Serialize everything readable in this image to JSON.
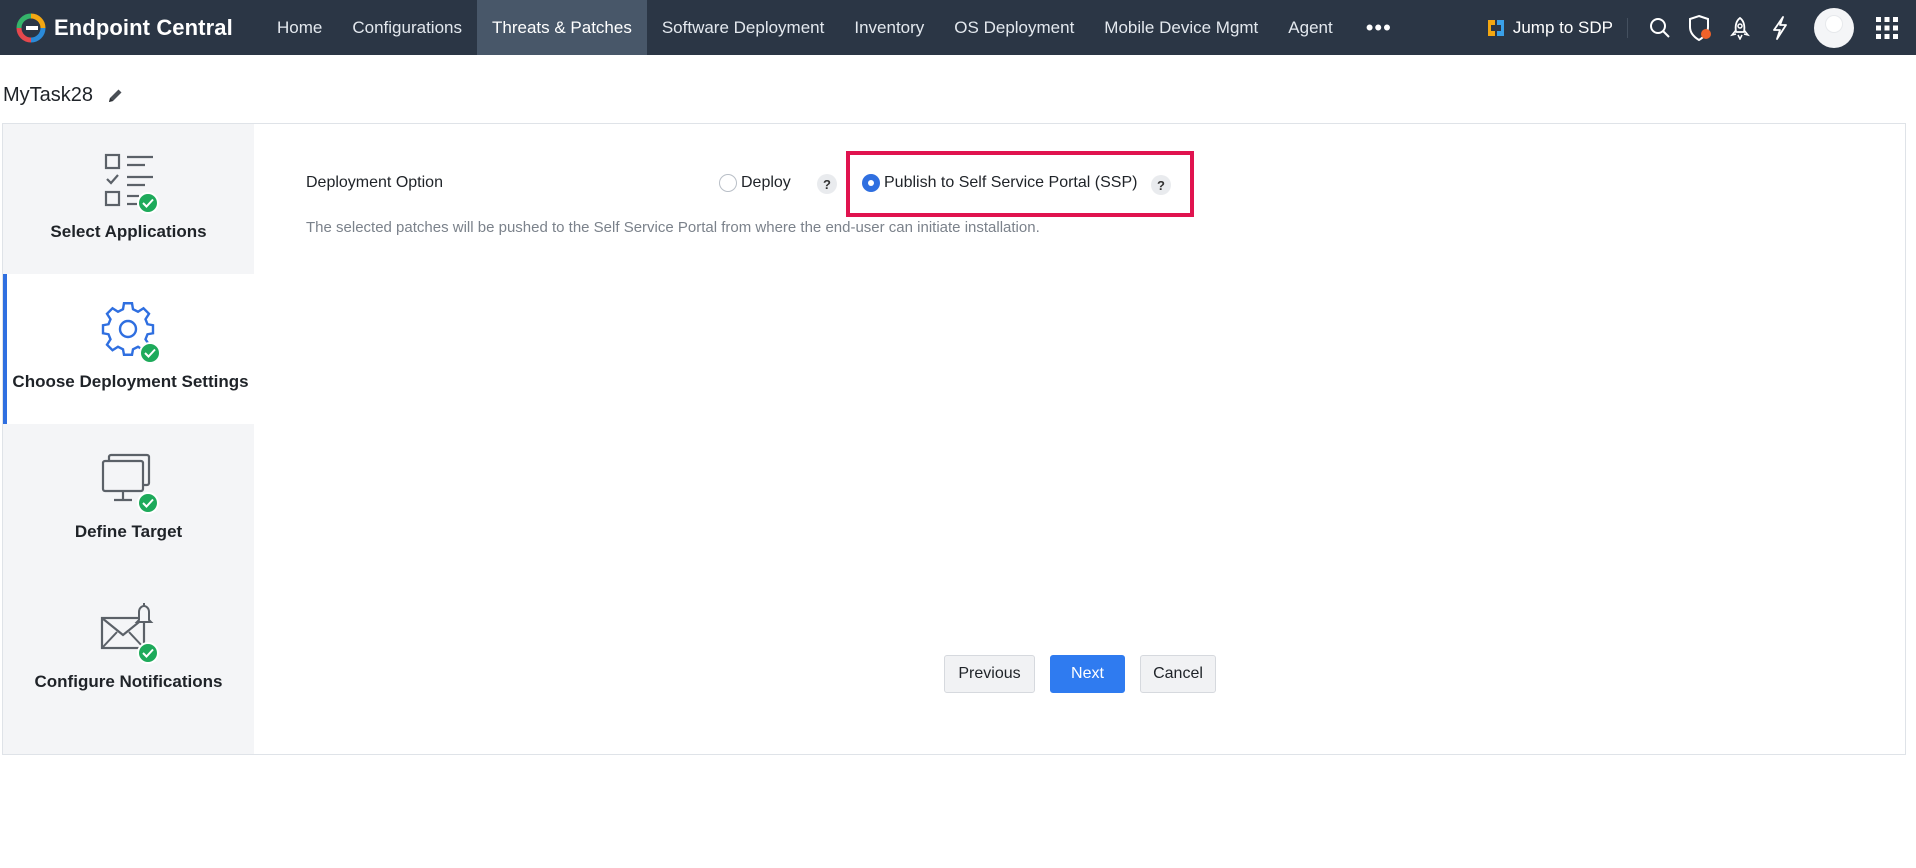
{
  "brand": {
    "name": "Endpoint Central"
  },
  "nav": {
    "items": [
      {
        "label": "Home"
      },
      {
        "label": "Configurations"
      },
      {
        "label": "Threats & Patches",
        "active": true
      },
      {
        "label": "Software Deployment"
      },
      {
        "label": "Inventory"
      },
      {
        "label": "OS Deployment"
      },
      {
        "label": "Mobile Device Mgmt"
      },
      {
        "label": "Agent"
      }
    ],
    "more": "•••"
  },
  "topbar": {
    "jump_sdp": "Jump to SDP",
    "icons": [
      "search-icon",
      "shield-alert-icon",
      "rocket-icon",
      "lightning-icon",
      "avatar",
      "apps-grid-icon"
    ]
  },
  "task": {
    "title": "MyTask28"
  },
  "steps": [
    {
      "label": "Select Applications",
      "icon": "checklist-icon",
      "completed": true
    },
    {
      "label": "Choose Deployment Settings",
      "icon": "gear-icon",
      "completed": true,
      "active": true
    },
    {
      "label": "Define Target",
      "icon": "monitor-icon",
      "completed": true
    },
    {
      "label": "Configure Notifications",
      "icon": "mail-bell-icon",
      "completed": true
    }
  ],
  "deployment": {
    "label": "Deployment Option",
    "options": [
      {
        "label": "Deploy",
        "selected": false
      },
      {
        "label": "Publish to Self Service Portal (SSP)",
        "selected": true
      }
    ],
    "help": "?",
    "description": "The selected patches will be pushed to the Self Service Portal from where the end-user can initiate installation."
  },
  "buttons": {
    "previous": "Previous",
    "next": "Next",
    "cancel": "Cancel"
  },
  "colors": {
    "topbar": "#2b3645",
    "active_nav": "#485769",
    "accent": "#2f7bf0",
    "success": "#1eaa5b",
    "highlight": "#e0134f"
  }
}
